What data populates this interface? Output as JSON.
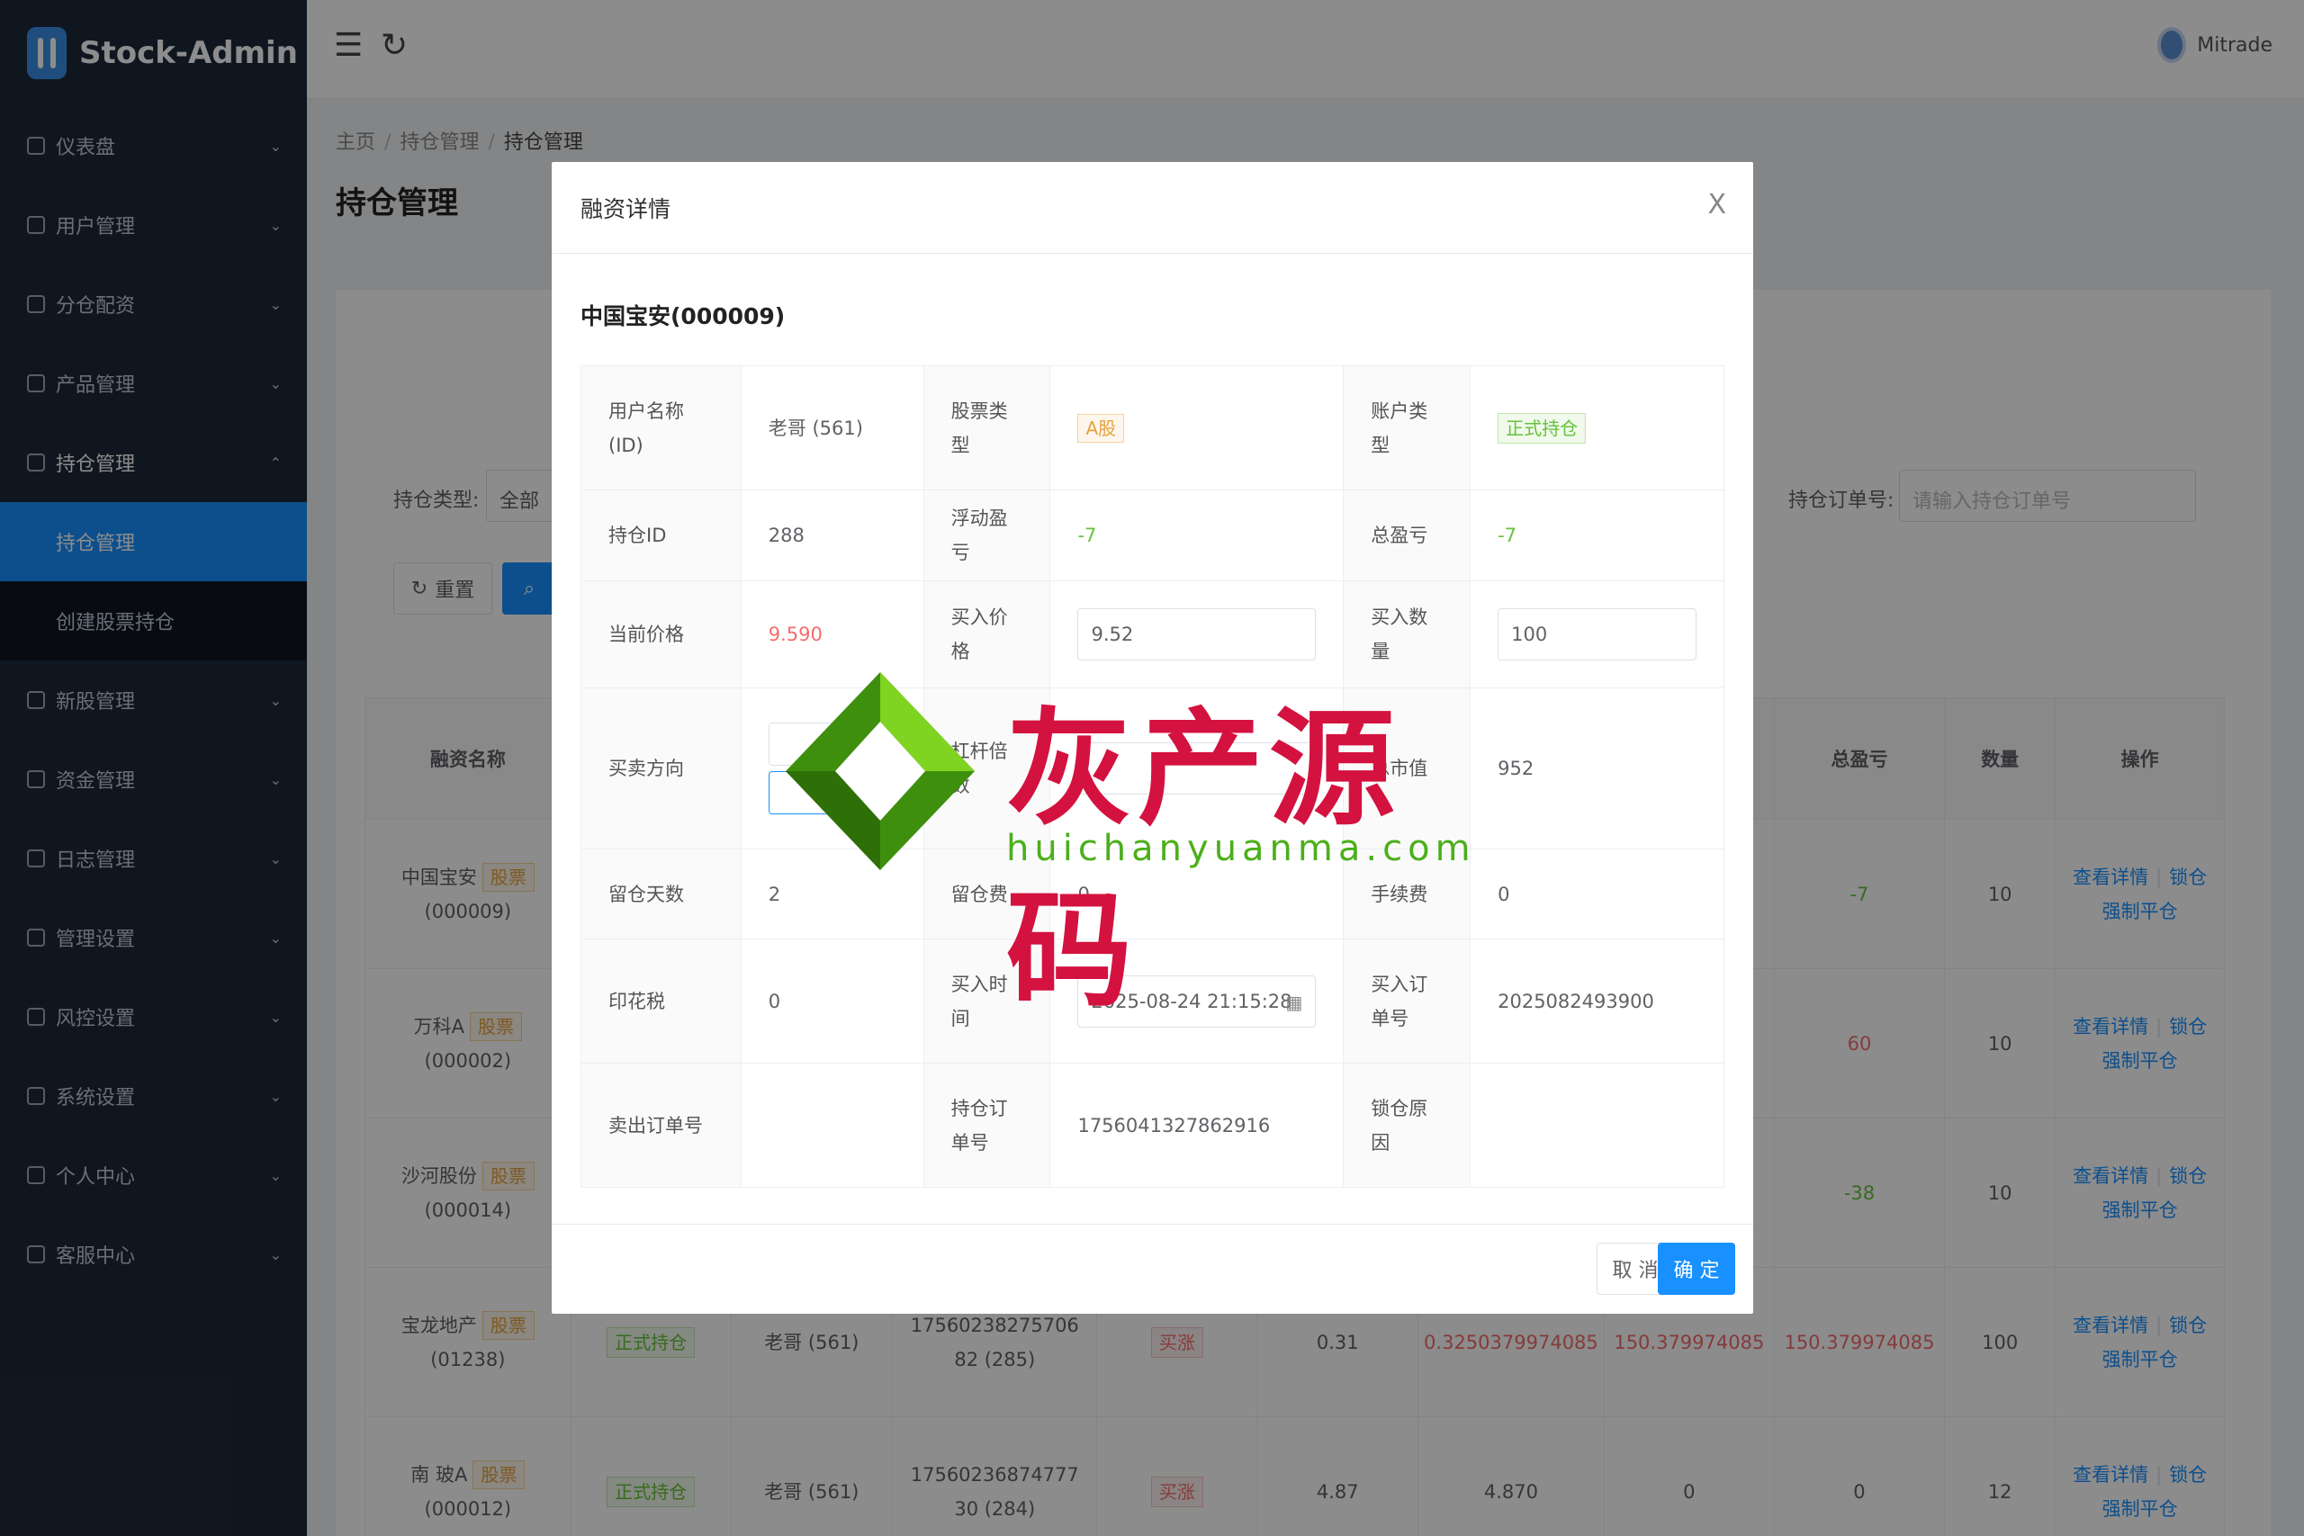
{
  "app": {
    "title": "Stock-Admin",
    "user": "Mitrade"
  },
  "sidebar": {
    "items": [
      {
        "label": "仪表盘",
        "icon": "dashboard-icon"
      },
      {
        "label": "用户管理",
        "icon": "user-icon"
      },
      {
        "label": "分仓配资",
        "icon": "branch-icon"
      },
      {
        "label": "产品管理",
        "icon": "chart-icon"
      },
      {
        "label": "持仓管理",
        "icon": "lock-icon",
        "open": true
      },
      {
        "label": "新股管理",
        "icon": "ipo-icon"
      },
      {
        "label": "资金管理",
        "icon": "money-icon"
      },
      {
        "label": "日志管理",
        "icon": "log-icon"
      },
      {
        "label": "管理设置",
        "icon": "admin-icon"
      },
      {
        "label": "风控设置",
        "icon": "warning-icon"
      },
      {
        "label": "系统设置",
        "icon": "gear-icon"
      },
      {
        "label": "个人中心",
        "icon": "person-icon"
      },
      {
        "label": "客服中心",
        "icon": "headset-icon"
      }
    ],
    "sub_items": [
      {
        "label": "持仓管理",
        "active": true
      },
      {
        "label": "创建股票持仓",
        "active": false
      }
    ]
  },
  "breadcrumb": [
    "主页",
    "持仓管理",
    "持仓管理"
  ],
  "page_title": "持仓管理",
  "filters": {
    "type_label": "持仓类型:",
    "type_value": "全部",
    "order_label": "持仓订单号:",
    "order_placeholder": "请输入持仓订单号",
    "reset": "重置"
  },
  "table": {
    "headers": [
      "融资名称",
      "总盈亏",
      "数量",
      "操作"
    ],
    "rows": [
      {
        "name": "中国宝安",
        "code": "(000009)",
        "tag": "股票",
        "total": "-7",
        "qty": "10",
        "cls": "green"
      },
      {
        "name": "万科A",
        "code": "(000002)",
        "tag": "股票",
        "total": "60",
        "qty": "10",
        "cls": "red"
      },
      {
        "name": "沙河股份",
        "code": "(000014)",
        "tag": "股票",
        "total": "-38",
        "qty": "10",
        "cls": "green"
      },
      {
        "name": "宝龙地产",
        "code": "(01238)",
        "tag": "股票",
        "acct": "正式持仓",
        "user": "老哥 (561)",
        "order": "17560238275706 82 (285)",
        "dir": "买涨",
        "price": "0.31",
        "cur": "0.3250379974085",
        "float": "150.379974085",
        "total": "150.379974085",
        "qty": "100",
        "cls": "red"
      },
      {
        "name": "南 玻A",
        "code": "(000012)",
        "tag": "股票",
        "acct": "正式持仓",
        "user": "老哥 (561)",
        "order": "17560236874777 30 (284)",
        "dir": "买涨",
        "price": "4.87",
        "cur": "4.870",
        "float": "0",
        "total": "0",
        "qty": "12",
        "cls": ""
      }
    ],
    "actions": {
      "detail": "查看详情",
      "lock": "锁仓",
      "close": "强制平仓"
    }
  },
  "modal": {
    "title": "融资详情",
    "close": "X",
    "stock": "中国宝安(000009)",
    "fields": {
      "user_label": "用户名称(ID)",
      "user": "老哥 (561)",
      "stock_type_label": "股票类型",
      "stock_type": "A股",
      "account_type_label": "账户类型",
      "account_type": "正式持仓",
      "pos_id_label": "持仓ID",
      "pos_id": "288",
      "float_label": "浮动盈亏",
      "float": "-7",
      "total_label": "总盈亏",
      "total": "-7",
      "cur_price_label": "当前价格",
      "cur_price": "9.590",
      "buy_price_label": "买入价格",
      "buy_price": "9.52",
      "buy_qty_label": "买入数量",
      "buy_qty": "100",
      "direction_label": "买卖方向",
      "leverage_label": "杠杆倍数",
      "total_price_label": "总市值",
      "total_price": "952",
      "days_label": "留仓天数",
      "days": "2",
      "hold_fee_label": "留仓费",
      "hold_fee": "0",
      "fee_label": "手续费",
      "fee": "0",
      "stamp_label": "印花税",
      "stamp": "0",
      "buy_time_label": "买入时间",
      "buy_time": "2025-08-24 21:15:28",
      "buy_order_label": "买入订单号",
      "buy_order": "2025082493900",
      "sell_order_label": "卖出订单号",
      "sell_order": "",
      "pos_order_label": "持仓订单号",
      "pos_order": "1756041327862916",
      "lock_reason_label": "锁仓原因",
      "lock_reason": ""
    },
    "cancel": "取 消",
    "ok": "确 定"
  },
  "watermark": {
    "text": "灰产源码",
    "url": "huichanyuanma.com"
  }
}
